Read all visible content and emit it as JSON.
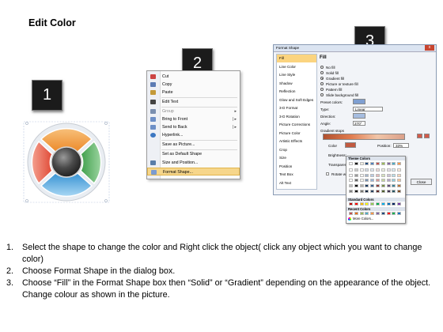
{
  "title": "Edit Color",
  "badges": [
    "1",
    "2",
    "3"
  ],
  "context_menu": {
    "items": [
      {
        "label": "Cut",
        "icon": "scissors-icon",
        "color": "#c44"
      },
      {
        "label": "Copy",
        "icon": "copy-icon",
        "color": "#5b7bb4"
      },
      {
        "label": "Paste",
        "icon": "clipboard-icon",
        "color": "#c49a3a"
      },
      {
        "label": "Edit Text",
        "icon": "text-icon",
        "color": "#444"
      },
      {
        "label": "Group",
        "icon": "group-icon",
        "color": "#7a8fb0",
        "submenu": true
      },
      {
        "label": "Bring to Front",
        "icon": "bring-front-icon",
        "color": "#6d8fc7",
        "submenu": true
      },
      {
        "label": "Send to Back",
        "icon": "send-back-icon",
        "color": "#6d8fc7",
        "submenu": true
      },
      {
        "label": "Hyperlink...",
        "icon": "globe-icon",
        "color": "#3c77c2"
      },
      {
        "label": "Save as Picture...",
        "icon": "",
        "color": ""
      },
      {
        "label": "Set as Default Shape",
        "icon": "",
        "color": ""
      },
      {
        "label": "Size and Position...",
        "icon": "size-icon",
        "color": "#5a7da8"
      },
      {
        "label": "Format Shape...",
        "icon": "format-shape-icon",
        "color": "#7b9bd1",
        "highlighted": true
      }
    ]
  },
  "dialog": {
    "title": "Format Shape",
    "close": "x",
    "nav": [
      "Fill",
      "Line Color",
      "Line Style",
      "Shadow",
      "Reflection",
      "Glow and Soft Edges",
      "3-D Format",
      "3-D Rotation",
      "Picture Corrections",
      "Picture Color",
      "Artistic Effects",
      "Crop",
      "Size",
      "Position",
      "Text Box",
      "Alt Text"
    ],
    "heading": "Fill",
    "options": [
      "No fill",
      "Solid fill",
      "Gradient fill",
      "Picture or texture fill",
      "Pattern fill",
      "Slide background fill"
    ],
    "preset_label": "Preset colors:",
    "type_label": "Type:",
    "type_value": "Linear",
    "direction_label": "Direction:",
    "angle_label": "Angle:",
    "angle_value": "270°",
    "stops_label": "Gradient stops",
    "color_label": "Color",
    "position_label": "Position:",
    "position_value": "33%",
    "brightness_label": "Brightness:",
    "transparency_label": "Transparency:",
    "rotate_label": "Rotate with shape",
    "close_button": "Close"
  },
  "palette": {
    "theme_header": "Theme Colors",
    "standard_header": "Standard Colors",
    "recent_header": "Recent Colors",
    "more": "More Colors...",
    "theme_top": [
      "#ffffff",
      "#000000",
      "#eeece1",
      "#1f497d",
      "#4f81bd",
      "#c0504d",
      "#9bbb59",
      "#8064a2",
      "#4bacc6",
      "#f79646"
    ],
    "standard": [
      "#c00000",
      "#ff0000",
      "#ffc000",
      "#ffff00",
      "#92d050",
      "#00b050",
      "#00b0f0",
      "#0070c0",
      "#002060",
      "#7030a0"
    ],
    "recent": [
      "#c0504d",
      "#e46c0a",
      "#9bbb59",
      "#4bacc6",
      "#f79646",
      "#8064a2",
      "#1f497d",
      "#ff0000",
      "#00b050",
      "#0070c0"
    ]
  },
  "instructions": [
    {
      "num": "1.",
      "text": "Select the shape to change the color and Right click the object( click any object which you want to change color)"
    },
    {
      "num": "2.",
      "text": "Choose Format Shape in the dialog box."
    },
    {
      "num": "3.",
      "text": "Choose “Fill” in the Format Shape box then “Solid” or “Gradient” depending on the appearance of the object. Change colour as shown in the picture."
    }
  ],
  "colors": {
    "segment_red": "#e8543f",
    "segment_green": "#55b45e",
    "segment_blue": "#4ea8e0",
    "segment_orange": "#f09a3c",
    "highlight": "#f6d68b"
  }
}
